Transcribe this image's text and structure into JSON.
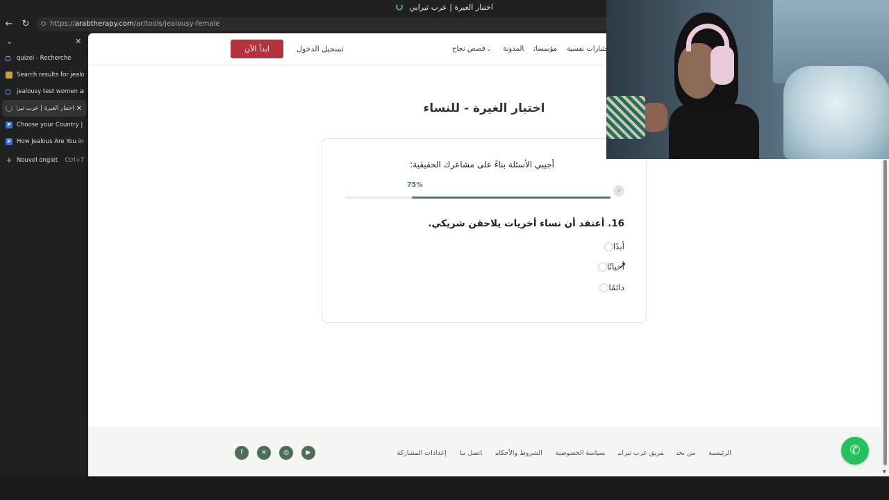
{
  "browser": {
    "window_title": "اختبار الغيرة | عرب ثيرابي",
    "url_prefix": "https://",
    "url_host": "arabtherapy.com",
    "url_path": "/ar/tools/jealousy-female"
  },
  "tabs": [
    {
      "label": "quizei - Recherche",
      "icon": "search-icon"
    },
    {
      "label": "Search results for jealousy",
      "icon": "image-icon"
    },
    {
      "label": "jealousy test women arabic",
      "icon": "search-icon"
    },
    {
      "label": "اختبار الغيرة | عرب ثيرابي",
      "icon": "loading-icon",
      "active": true
    },
    {
      "label": "Choose your Country | Psy",
      "icon": "pt-icon"
    },
    {
      "label": "How Jealous Are You in Yo",
      "icon": "pt-icon"
    }
  ],
  "new_tab": {
    "label": "Nouvel onglet",
    "shortcut": "Ctrl+T"
  },
  "header": {
    "start_button": "ابدأ الآن",
    "login": "تسجيل الدخول",
    "nav": [
      "اختبارات نفسية",
      "مؤسسات",
      "المدونة",
      "قصص نجاح"
    ]
  },
  "quiz": {
    "page_title": "اختبار الغيرة - للنساء",
    "instruction": "أجيبي الأسئلة بناءً على مشاعرك الحقيقية:",
    "progress_label": "75%",
    "progress_value": 75,
    "question": "16. أعتقد أن نساء أخريات يلاحقن شريكي.",
    "options": [
      "أبدًا",
      "أحيانًا",
      "دائمًا"
    ]
  },
  "footer": {
    "links": [
      "الرئيسية",
      "من نحن",
      "فريق عرب ثيرابي",
      "سياسة الخصوصية",
      "الشروط والأحكام",
      "اتصل بنا",
      "إعدادات المشاركة"
    ],
    "social": [
      "youtube-icon",
      "instagram-icon",
      "x-icon",
      "facebook-icon"
    ]
  },
  "colors": {
    "accent_red": "#b3323c",
    "progress_green": "#4a7d5f",
    "whatsapp_green": "#25c15c"
  }
}
